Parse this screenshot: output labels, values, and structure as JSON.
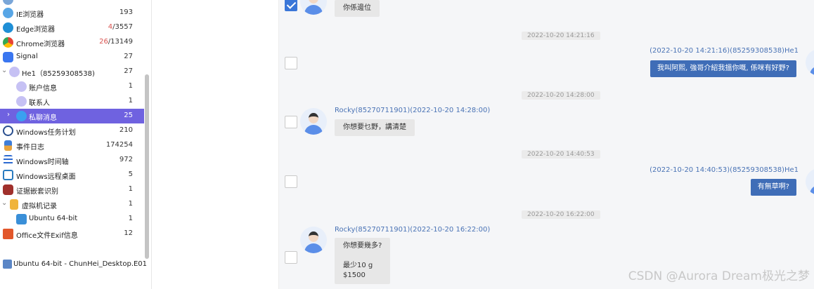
{
  "tree": {
    "items": [
      {
        "label": "IE浏览器",
        "count": "193"
      },
      {
        "label": "Edge浏览器",
        "count_warn": "4",
        "count_rest": "/3557"
      },
      {
        "label": "Chrome浏览器",
        "count_warn": "26",
        "count_rest": "/13149"
      },
      {
        "label": "Signal",
        "count": "27"
      },
      {
        "label": "He1（85259308538)",
        "count": "27"
      },
      {
        "label": "账户信息",
        "count": "1"
      },
      {
        "label": "联系人",
        "count": "1"
      },
      {
        "label": "私聊消息",
        "count": "25"
      },
      {
        "label": "Windows任务计划",
        "count": "210"
      },
      {
        "label": "事件日志",
        "count": "174254"
      },
      {
        "label": "Windows时间轴",
        "count": "972"
      },
      {
        "label": "Windows远程桌面",
        "count": "5"
      },
      {
        "label": "证据嵌套识别",
        "count": "1"
      },
      {
        "label": "虚拟机记录",
        "count": "1"
      },
      {
        "label": "Ubuntu 64-bit",
        "count": "1"
      },
      {
        "label": "Office文件Exif信息",
        "count": "12"
      }
    ],
    "evidence_label": "Ubuntu 64-bit - ChunHei_Desktop.E01"
  },
  "chat": {
    "first_message": "你係邊位",
    "timestamps": [
      "2022-10-20 14:21:16",
      "2022-10-20 14:28:00",
      "2022-10-20 14:40:53",
      "2022-10-20 16:22:00"
    ],
    "messages": [
      {
        "sender": "(2022-10-20 14:21:16)(85259308538)He1",
        "text": "我叫阿熙, 強哥介紹我搵你嘅, 係咪有好野?"
      },
      {
        "sender": "Rocky(85270711901)(2022-10-20 14:28:00)",
        "text": "你想要乜野，講清楚"
      },
      {
        "sender": "(2022-10-20 14:40:53)(85259308538)He1",
        "text": "有無草啊?"
      },
      {
        "sender": "Rocky(85270711901)(2022-10-20 16:22:00)",
        "text": "你想要幾多?\n\n最少10 g\n$1500"
      }
    ]
  },
  "watermark": "CSDN @Aurora Dream极光之梦",
  "colors": {
    "selected_row": "#6f62e0",
    "outgoing_bubble": "#3f6db7",
    "sender_name": "#4a73b5",
    "warn_count": "#d9534f"
  }
}
